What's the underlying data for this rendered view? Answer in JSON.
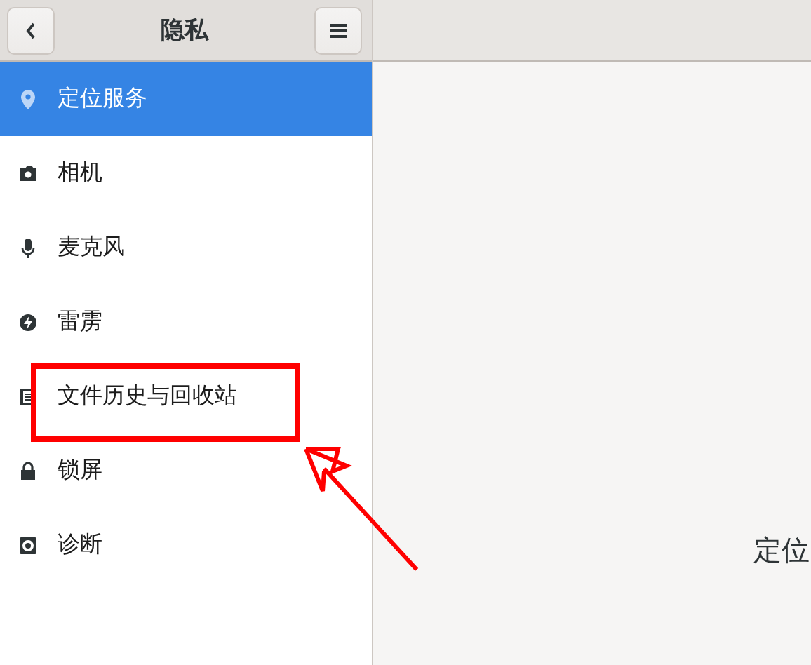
{
  "header": {
    "title": "隐私"
  },
  "sidebar": {
    "items": [
      {
        "label": "定位服务",
        "kind": "pin",
        "selected": true
      },
      {
        "label": "相机",
        "kind": "camera",
        "selected": false
      },
      {
        "label": "麦克风",
        "kind": "mic",
        "selected": false
      },
      {
        "label": "雷雳",
        "kind": "bolt",
        "selected": false
      },
      {
        "label": "文件历史与回收站",
        "kind": "doc",
        "selected": false
      },
      {
        "label": "锁屏",
        "kind": "lock",
        "selected": false
      },
      {
        "label": "诊断",
        "kind": "diag",
        "selected": false
      }
    ]
  },
  "content": {
    "heading": "定位"
  }
}
